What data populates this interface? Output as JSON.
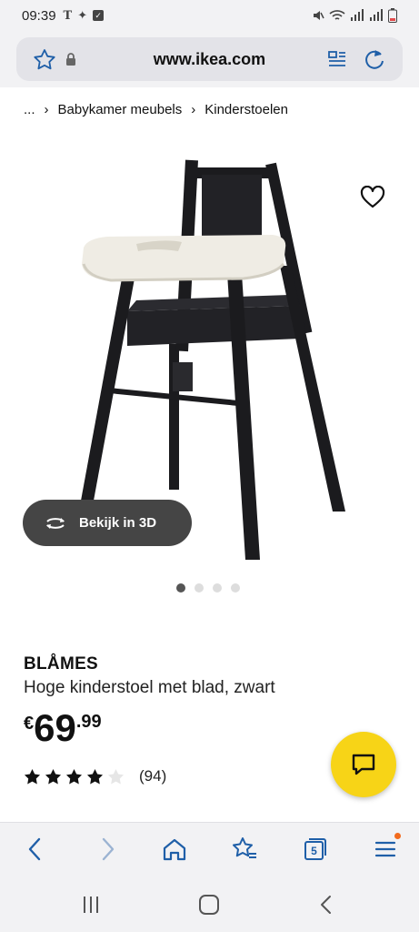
{
  "status": {
    "time": "09:39"
  },
  "browser": {
    "url": "www.ikea.com",
    "tab_count": "5"
  },
  "breadcrumb": {
    "ellipsis": "...",
    "items": [
      "Babykamer meubels",
      "Kinderstoelen"
    ]
  },
  "gallery": {
    "view_3d_label": "Bekijk in 3D",
    "slide_count": 4,
    "active_slide": 1
  },
  "product": {
    "name": "BLÅMES",
    "description": "Hoge kinderstoel met blad, zwart",
    "price_currency": "€",
    "price_integer": "69",
    "price_decimal": ".99",
    "rating": 4,
    "rating_max": 5,
    "review_count": "(94)"
  },
  "colors": {
    "accent_chat": "#f7d417",
    "browser_accent": "#1f5fa8",
    "notification_dot": "#f26b1d"
  },
  "icons": [
    "star-bookmark-icon",
    "lock-icon",
    "reader-mode-icon",
    "reload-icon",
    "heart-icon",
    "rotate-3d-icon",
    "chat-icon",
    "back-icon",
    "forward-icon",
    "home-icon",
    "bookmarks-icon",
    "tabs-icon",
    "menu-icon",
    "recents-icon",
    "home-nav-icon",
    "back-nav-icon"
  ]
}
